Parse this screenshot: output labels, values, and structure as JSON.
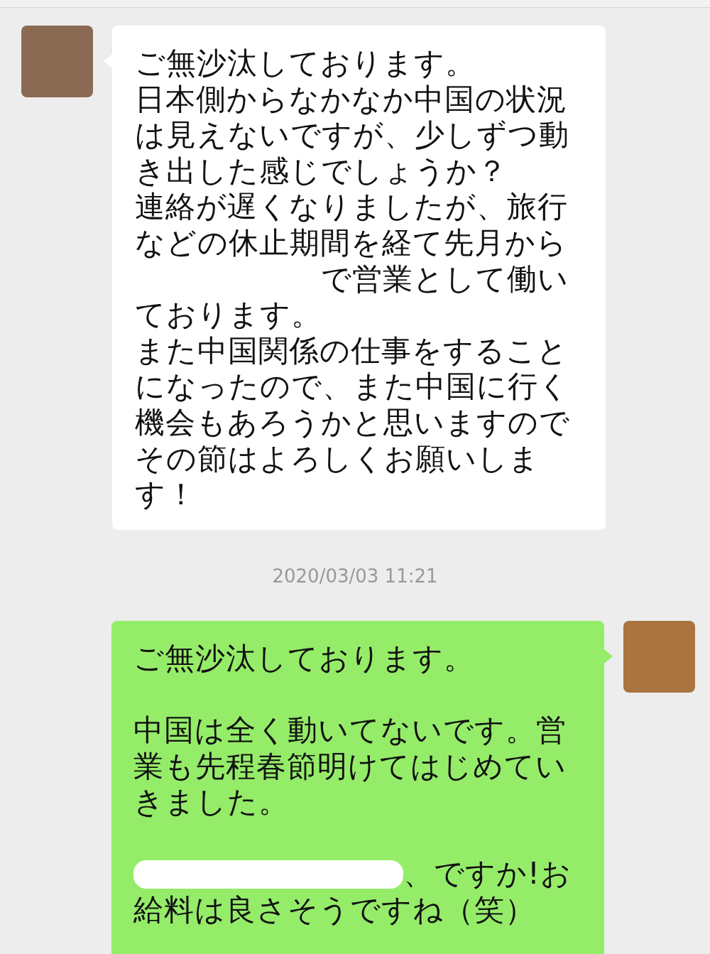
{
  "messages": [
    {
      "kind": "incoming",
      "parts": [
        {
          "kind": "text",
          "text": "ご無沙汰しております。"
        },
        {
          "kind": "text",
          "text": "日本側からなかなか中国の状況は見えないですが、少しずつ動き出した感じでしょうか？"
        },
        {
          "kind": "text",
          "text": "連絡が遅くなりましたが、旅行などの休止期間を経て先月から"
        },
        {
          "kind": "redaction"
        },
        {
          "kind": "text",
          "text": "で営業として働いております。"
        },
        {
          "kind": "text",
          "text": "また中国関係の仕事をすることになったので、また中国に行く機会もあろうかと思いますのでその節はよろしくお願いします！"
        }
      ]
    },
    {
      "kind": "timestamp",
      "text": "2020/03/03 11:21"
    },
    {
      "kind": "outgoing",
      "parts": [
        {
          "kind": "text",
          "text": "ご無沙汰しております。"
        },
        {
          "kind": "blank"
        },
        {
          "kind": "text",
          "text": "中国は全く動いてないです。営業も先程春節明けてはじめていきました。"
        },
        {
          "kind": "blank"
        },
        {
          "kind": "redaction"
        },
        {
          "kind": "text",
          "text": "、ですか!お"
        },
        {
          "kind": "text",
          "text": "給料は良さそうですね（笑）"
        }
      ]
    }
  ]
}
